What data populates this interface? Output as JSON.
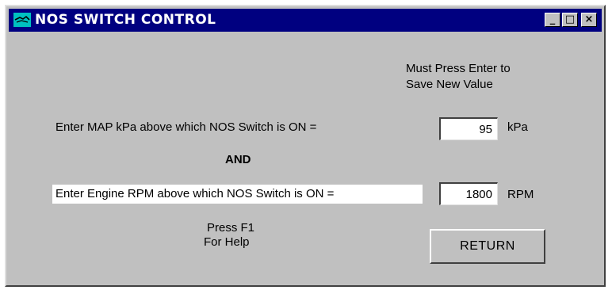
{
  "window": {
    "title": "NOS SWITCH CONTROL",
    "buttons": {
      "minimize": "_",
      "maximize": "□",
      "close": "×"
    }
  },
  "note": {
    "line1": "Must Press Enter to",
    "line2": "Save New Value"
  },
  "map": {
    "label": "Enter MAP kPa above which NOS Switch is ON =",
    "value": "95",
    "unit": "kPa"
  },
  "and_label": "AND",
  "rpm": {
    "label": "Enter Engine RPM above which NOS Switch is ON =",
    "value": "1800",
    "unit": "RPM"
  },
  "help": {
    "line1": "Press F1",
    "line2": "For Help"
  },
  "return_label": "RETURN",
  "colors": {
    "titlebar": "#000080",
    "face": "#c0c0c0",
    "icon": "#00c0c0"
  },
  "icons": [
    "app-icon",
    "minimize-icon",
    "maximize-icon",
    "close-icon"
  ]
}
